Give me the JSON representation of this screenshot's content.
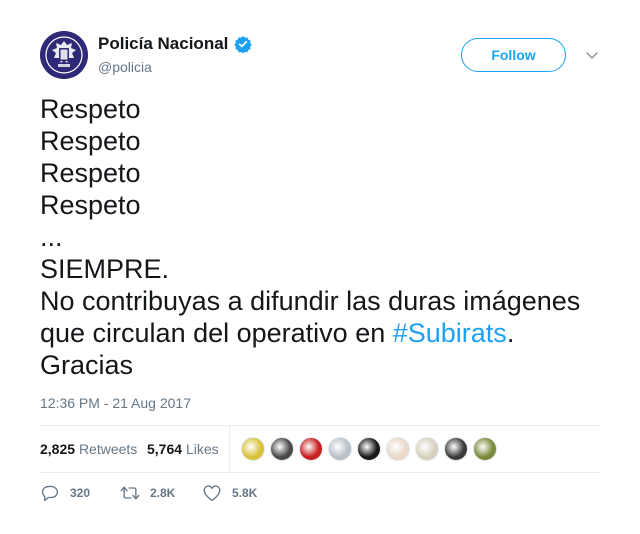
{
  "account": {
    "display_name": "Policía Nacional",
    "handle": "@policia",
    "verified_icon": "verified-badge-icon",
    "avatar_color": "#2f2a78"
  },
  "follow_label": "Follow",
  "tweet_lines": [
    "Respeto",
    "Respeto",
    "Respeto",
    "Respeto",
    "...",
    "SIEMPRE.",
    "No contribuyas a difundir las duras imágenes"
  ],
  "tweet_last": {
    "prefix": "que circulan del operativo en ",
    "hashtag": "#Subirats",
    "suffix": "."
  },
  "tweet_final_line": "Gracias",
  "timestamp": "12:36 PM - 21 Aug 2017",
  "stats": {
    "retweets_count": "2,825",
    "retweets_label": "Retweets",
    "likes_count": "5,764",
    "likes_label": "Likes"
  },
  "liker_avatars": [
    "#d9c23a",
    "#4a4a4a",
    "#c81e1e",
    "#b8c0c8",
    "#1a1a1a",
    "#e8d8c8",
    "#d8d0c0",
    "#3a3a3a",
    "#7a8a3a"
  ],
  "actions": {
    "reply_count": "320",
    "retweet_count": "2.8K",
    "like_count": "5.8K"
  },
  "colors": {
    "accent": "#1da1f2",
    "muted": "#657786",
    "text": "#14171a"
  }
}
